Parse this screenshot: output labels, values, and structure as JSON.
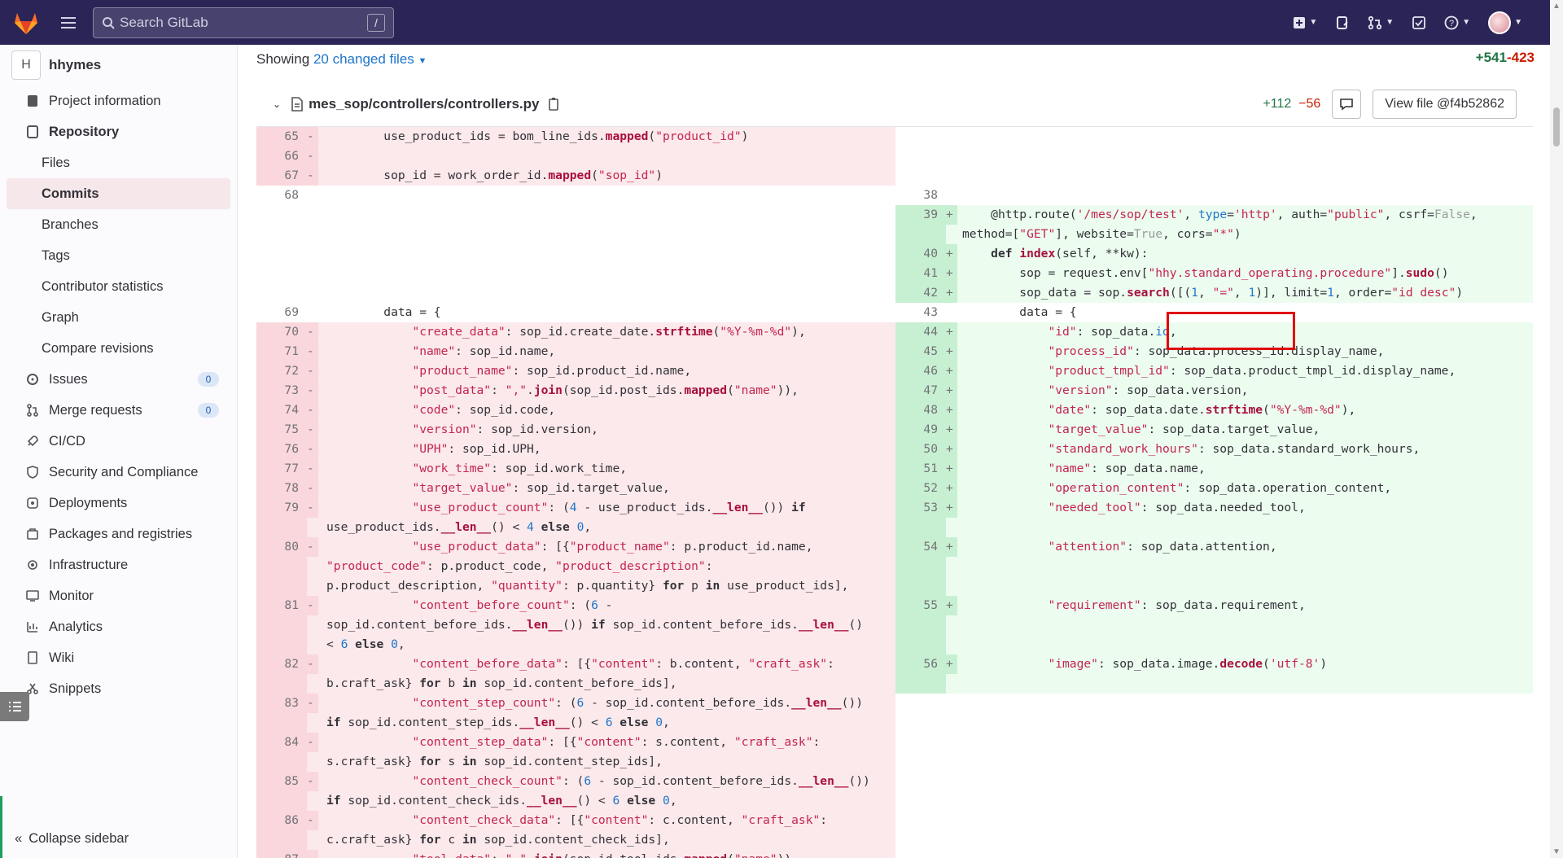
{
  "topbar": {
    "search_placeholder": "Search GitLab",
    "search_shortcut": "/"
  },
  "project": {
    "avatar_letter": "H",
    "name": "hhymes"
  },
  "sidebar": {
    "items": [
      {
        "label": "Project information"
      },
      {
        "label": "Repository"
      },
      {
        "label": "Files"
      },
      {
        "label": "Commits"
      },
      {
        "label": "Branches"
      },
      {
        "label": "Tags"
      },
      {
        "label": "Contributor statistics"
      },
      {
        "label": "Graph"
      },
      {
        "label": "Compare revisions"
      },
      {
        "label": "Issues",
        "count": "0"
      },
      {
        "label": "Merge requests",
        "count": "0"
      },
      {
        "label": "CI/CD"
      },
      {
        "label": "Security and Compliance"
      },
      {
        "label": "Deployments"
      },
      {
        "label": "Packages and registries"
      },
      {
        "label": "Infrastructure"
      },
      {
        "label": "Monitor"
      },
      {
        "label": "Analytics"
      },
      {
        "label": "Wiki"
      },
      {
        "label": "Snippets"
      }
    ],
    "collapse_label": "Collapse sidebar"
  },
  "diff_summary": {
    "showing_prefix": "Showing",
    "changed_files": "20 changed files",
    "additions": "+541",
    "deletions": "-423"
  },
  "file": {
    "path": "mes_sop/controllers/controllers.py",
    "additions": "+112",
    "deletions": "−56",
    "view_button": "View file @f4b52862"
  },
  "colors": {
    "topbar": "#2b2557",
    "deleted_bg": "#fbe9eb",
    "added_bg": "#ecfdf0",
    "link": "#1f75cb",
    "highlight_box": "#e00000"
  }
}
